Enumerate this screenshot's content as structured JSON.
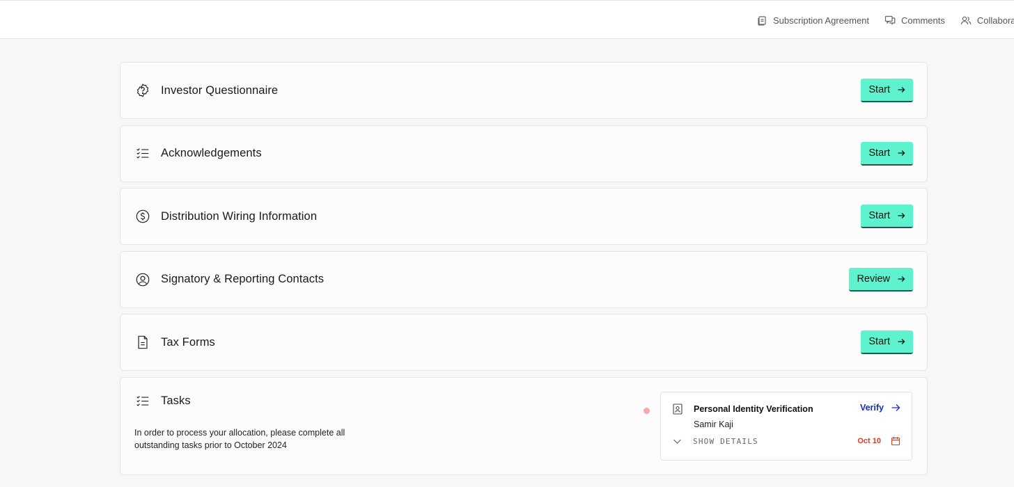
{
  "topnav": {
    "items": [
      {
        "label": "Subscription Agreement",
        "icon": "document-stack-icon"
      },
      {
        "label": "Comments",
        "icon": "comments-icon"
      },
      {
        "label": "Collaborators",
        "icon": "users-icon"
      }
    ]
  },
  "sections": [
    {
      "title": "Investor Questionnaire",
      "icon": "badge-question-icon",
      "action": "Start"
    },
    {
      "title": "Acknowledgements",
      "icon": "checklist-icon",
      "action": "Start"
    },
    {
      "title": "Distribution Wiring Information",
      "icon": "dollar-circle-icon",
      "action": "Start"
    },
    {
      "title": "Signatory & Reporting Contacts",
      "icon": "user-circle-icon",
      "action": "Review"
    },
    {
      "title": "Tax Forms",
      "icon": "document-icon",
      "action": "Start"
    }
  ],
  "tasks": {
    "title": "Tasks",
    "icon": "checklist-icon",
    "description": "In order to process your allocation, please complete all outstanding tasks prior to October 2024",
    "item": {
      "title": "Personal Identity Verification",
      "subtitle": "Samir Kaji",
      "action": "Verify",
      "toggle_label": "SHOW DETAILS",
      "due_date": "Oct 10"
    }
  },
  "colors": {
    "accent": "#5ef2cf",
    "link": "#1a2bc2",
    "due": "#d93b1f",
    "dot": "#f4aaa8"
  }
}
